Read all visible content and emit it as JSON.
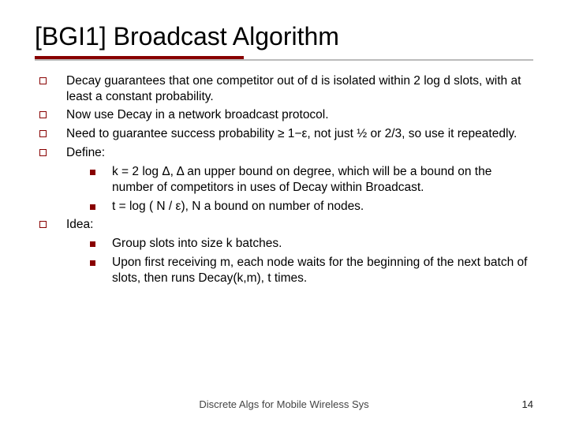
{
  "title": {
    "ref": "[BGI1]",
    "text": "Broadcast Algorithm"
  },
  "bullets": [
    {
      "text": "Decay guarantees that one competitor out of d is isolated within 2 log d slots, with at least a constant probability."
    },
    {
      "text": "Now use Decay in a network broadcast protocol."
    },
    {
      "text": "Need to guarantee success probability ≥ 1−ε, not just ½ or 2/3, so use it repeatedly."
    },
    {
      "text": "Define:",
      "children": [
        "k = 2 log Δ, Δ an upper bound on degree, which will be a bound on the number of competitors in uses of Decay within Broadcast.",
        "t = log ( N / ε), N a bound on number of nodes."
      ]
    },
    {
      "text": "Idea:",
      "children": [
        "Group slots into size k batches.",
        "Upon first receiving m, each node waits for the beginning of the next batch of slots, then runs Decay(k,m), t times."
      ]
    }
  ],
  "footer": {
    "center": "Discrete Algs for Mobile Wireless Sys",
    "page": "14"
  }
}
